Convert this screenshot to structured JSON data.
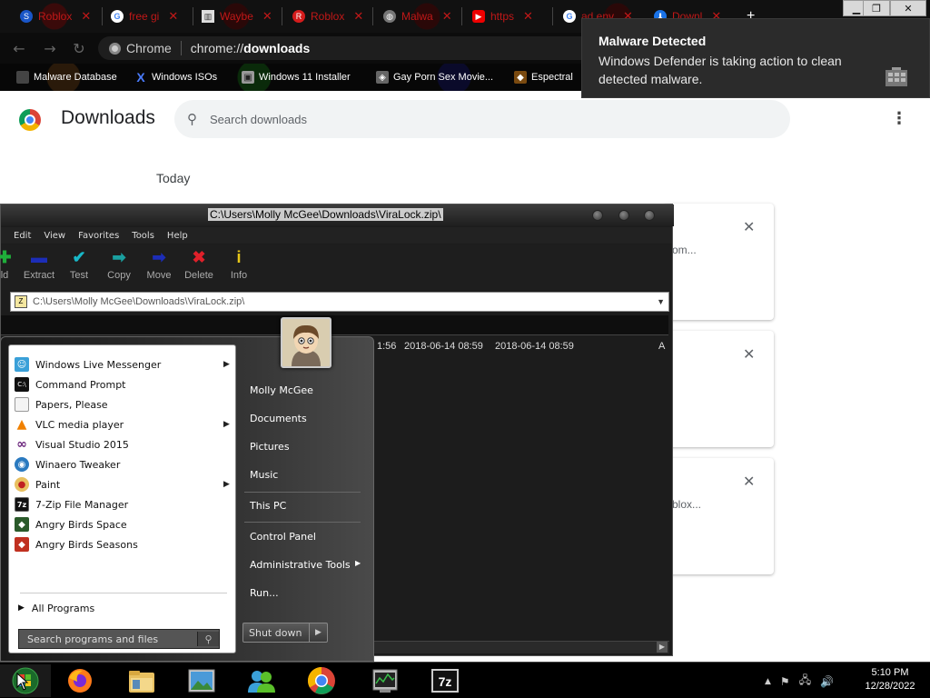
{
  "browser": {
    "tabs": [
      {
        "label": "Roblox",
        "icon": "roblox-icon",
        "color": "#c01818"
      },
      {
        "label": "free gi",
        "icon": "google-icon",
        "color": "#c01818"
      },
      {
        "label": "Waybe",
        "icon": "wayback-machine-icon",
        "color": "#c01818"
      },
      {
        "label": "Roblox",
        "icon": "roblox-red-icon",
        "color": "#c01818"
      },
      {
        "label": "Malwa",
        "icon": "globe-icon",
        "color": "#c01818"
      },
      {
        "label": "https",
        "icon": "youtube-icon",
        "color": "#c01818"
      },
      {
        "label": "ad env",
        "icon": "google-icon",
        "color": "#c01818"
      },
      {
        "label": "Downl",
        "icon": "download-icon",
        "color": "#c01818"
      }
    ],
    "omnibox": {
      "site": "Chrome",
      "url_prefix": "chrome://",
      "url_bold": "downloads"
    },
    "bookmarks": [
      {
        "label": "Malware Database",
        "icon": "bookmark-icon"
      },
      {
        "label": "Windows ISOs",
        "icon": "x-icon"
      },
      {
        "label": "Windows 11 Installer",
        "icon": "image-icon"
      },
      {
        "label": "Gay Porn Sex Movie...",
        "icon": "bookmark-icon"
      },
      {
        "label": "Espectral",
        "icon": "bookmark-icon"
      }
    ]
  },
  "toast": {
    "title": "Malware Detected",
    "message": "Windows Defender is taking action to clean detected malware."
  },
  "downloads_page": {
    "title": "Downloads",
    "search_placeholder": "Search downloads",
    "section": "Today",
    "cards": [
      {
        "fragment": "om..."
      },
      {
        "fragment": ""
      },
      {
        "fragment": "blox..."
      }
    ]
  },
  "zip_window": {
    "title": "C:\\Users\\Molly McGee\\Downloads\\ViraLock.zip\\",
    "menu": [
      "Edit",
      "View",
      "Favorites",
      "Tools",
      "Help"
    ],
    "tools": [
      {
        "label": "ld",
        "icon": "add-icon"
      },
      {
        "label": "Extract",
        "icon": "extract-icon"
      },
      {
        "label": "Test",
        "icon": "test-icon"
      },
      {
        "label": "Copy",
        "icon": "copy-icon"
      },
      {
        "label": "Move",
        "icon": "move-icon"
      },
      {
        "label": "Delete",
        "icon": "delete-icon"
      },
      {
        "label": "Info",
        "icon": "info-icon"
      }
    ],
    "address": "C:\\Users\\Molly McGee\\Downloads\\ViraLock.zip\\",
    "row": {
      "time_fragment": "1:56",
      "modified": "2018-06-14 08:59",
      "created": "2018-06-14 08:59",
      "attr": "A"
    }
  },
  "start_menu": {
    "programs": [
      {
        "label": "Windows Live Messenger",
        "icon": "messenger-icon",
        "submenu": true
      },
      {
        "label": "Command Prompt",
        "icon": "command-prompt-icon",
        "submenu": false
      },
      {
        "label": "Papers, Please",
        "icon": "document-icon",
        "submenu": false
      },
      {
        "label": "VLC media player",
        "icon": "vlc-icon",
        "submenu": true
      },
      {
        "label": "Visual Studio 2015",
        "icon": "visual-studio-icon",
        "submenu": false
      },
      {
        "label": "Winaero Tweaker",
        "icon": "winaero-icon",
        "submenu": false
      },
      {
        "label": "Paint",
        "icon": "paint-icon",
        "submenu": true
      },
      {
        "label": "7-Zip File Manager",
        "icon": "7zip-icon",
        "submenu": false
      },
      {
        "label": "Angry Birds Space",
        "icon": "angry-birds-space-icon",
        "submenu": false
      },
      {
        "label": "Angry Birds Seasons",
        "icon": "angry-birds-seasons-icon",
        "submenu": false
      }
    ],
    "all_programs": "All Programs",
    "search_placeholder": "Search programs and files",
    "right_items": [
      "Molly McGee",
      "Documents",
      "Pictures",
      "Music",
      "This PC",
      "Control Panel",
      "Administrative Tools",
      "Run..."
    ],
    "shutdown": "Shut down"
  },
  "taskbar": {
    "apps": [
      "start-orb",
      "firefox",
      "file-explorer",
      "photos",
      "live-messenger",
      "chrome",
      "task-manager",
      "7zip"
    ],
    "time": "5:10 PM",
    "date": "12/28/2022"
  }
}
